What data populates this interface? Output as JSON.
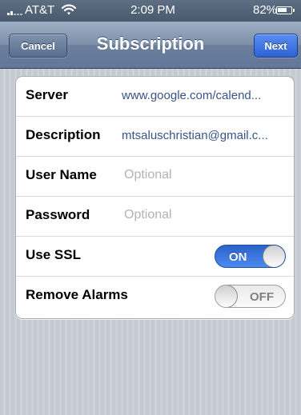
{
  "status_bar": {
    "carrier": "AT&T",
    "time": "2:09 PM",
    "battery_percent": "82%",
    "battery_level": 0.82,
    "icons": [
      "signal-bars-icon",
      "wifi-icon",
      "battery-icon"
    ]
  },
  "nav": {
    "title": "Subscription",
    "cancel_label": "Cancel",
    "next_label": "Next"
  },
  "form": {
    "server": {
      "label": "Server",
      "value": "www.google.com/calend..."
    },
    "description": {
      "label": "Description",
      "value": "mtsaluschristian@gmail.c..."
    },
    "user_name": {
      "label": "User Name",
      "placeholder": "Optional"
    },
    "password": {
      "label": "Password",
      "placeholder": "Optional"
    },
    "use_ssl": {
      "label": "Use SSL",
      "state": "ON"
    },
    "remove_alarms": {
      "label": "Remove Alarms",
      "state": "OFF"
    }
  },
  "colors": {
    "nav_bar": "#7d90aa",
    "next_button": "#2d62d6",
    "switch_on": "#4d8bf0",
    "value_text": "#385487",
    "placeholder_text": "#b3b3b3"
  }
}
